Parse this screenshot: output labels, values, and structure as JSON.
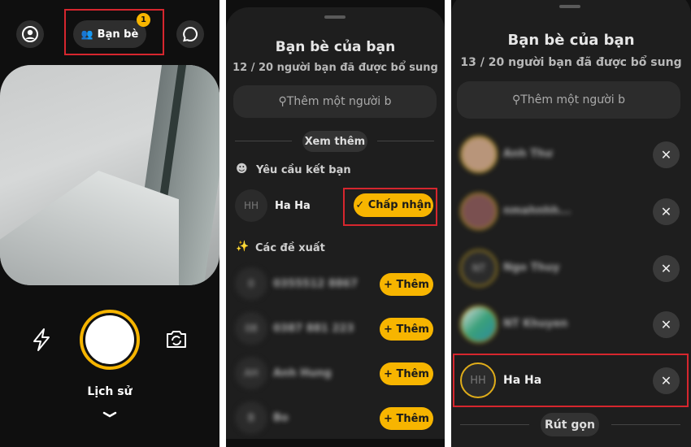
{
  "camera": {
    "friends_button": "Bạn bè",
    "friends_badge": "1",
    "history_label": "Lịch sử",
    "icons": [
      "profile-icon",
      "friends-icon",
      "chat-icon",
      "flash-icon",
      "shutter-icon",
      "flip-camera-icon",
      "chevron-down-icon"
    ],
    "accent": "#f7b500"
  },
  "friends_sheet": {
    "title": "Bạn bè của bạn",
    "subtitle": "12 / 20 người bạn đã được bổ sung",
    "search_placeholder": "Thêm một người b",
    "see_more": "Xem thêm",
    "requests_header": "Yêu cầu kết bạn",
    "request": {
      "initials": "HH",
      "name": "Ha Ha",
      "accept_label": "✓ Chấp nhận"
    },
    "suggestions_header": "Các đề xuất",
    "add_label": "+ Thêm",
    "suggestions": [
      {
        "initials": "0",
        "name": "0355512 8867"
      },
      {
        "initials": "08",
        "name": "0387 881 223"
      },
      {
        "initials": "AH",
        "name": "Anh Hung"
      },
      {
        "initials": "B",
        "name": "Bo"
      }
    ]
  },
  "friends_list": {
    "title": "Bạn bè của bạn",
    "subtitle": "13 / 20 người bạn đã được bổ sung",
    "search_placeholder": "Thêm một người b",
    "friends": [
      {
        "initials": "",
        "name": "Anh Thư"
      },
      {
        "initials": "",
        "name": "nmahnhh..."
      },
      {
        "initials": "NT",
        "name": "Ngo Thuy"
      },
      {
        "initials": "",
        "name": "NT Khuyen"
      },
      {
        "initials": "HH",
        "name": "Ha Ha"
      }
    ],
    "collapse_label": "Rút gọn"
  }
}
